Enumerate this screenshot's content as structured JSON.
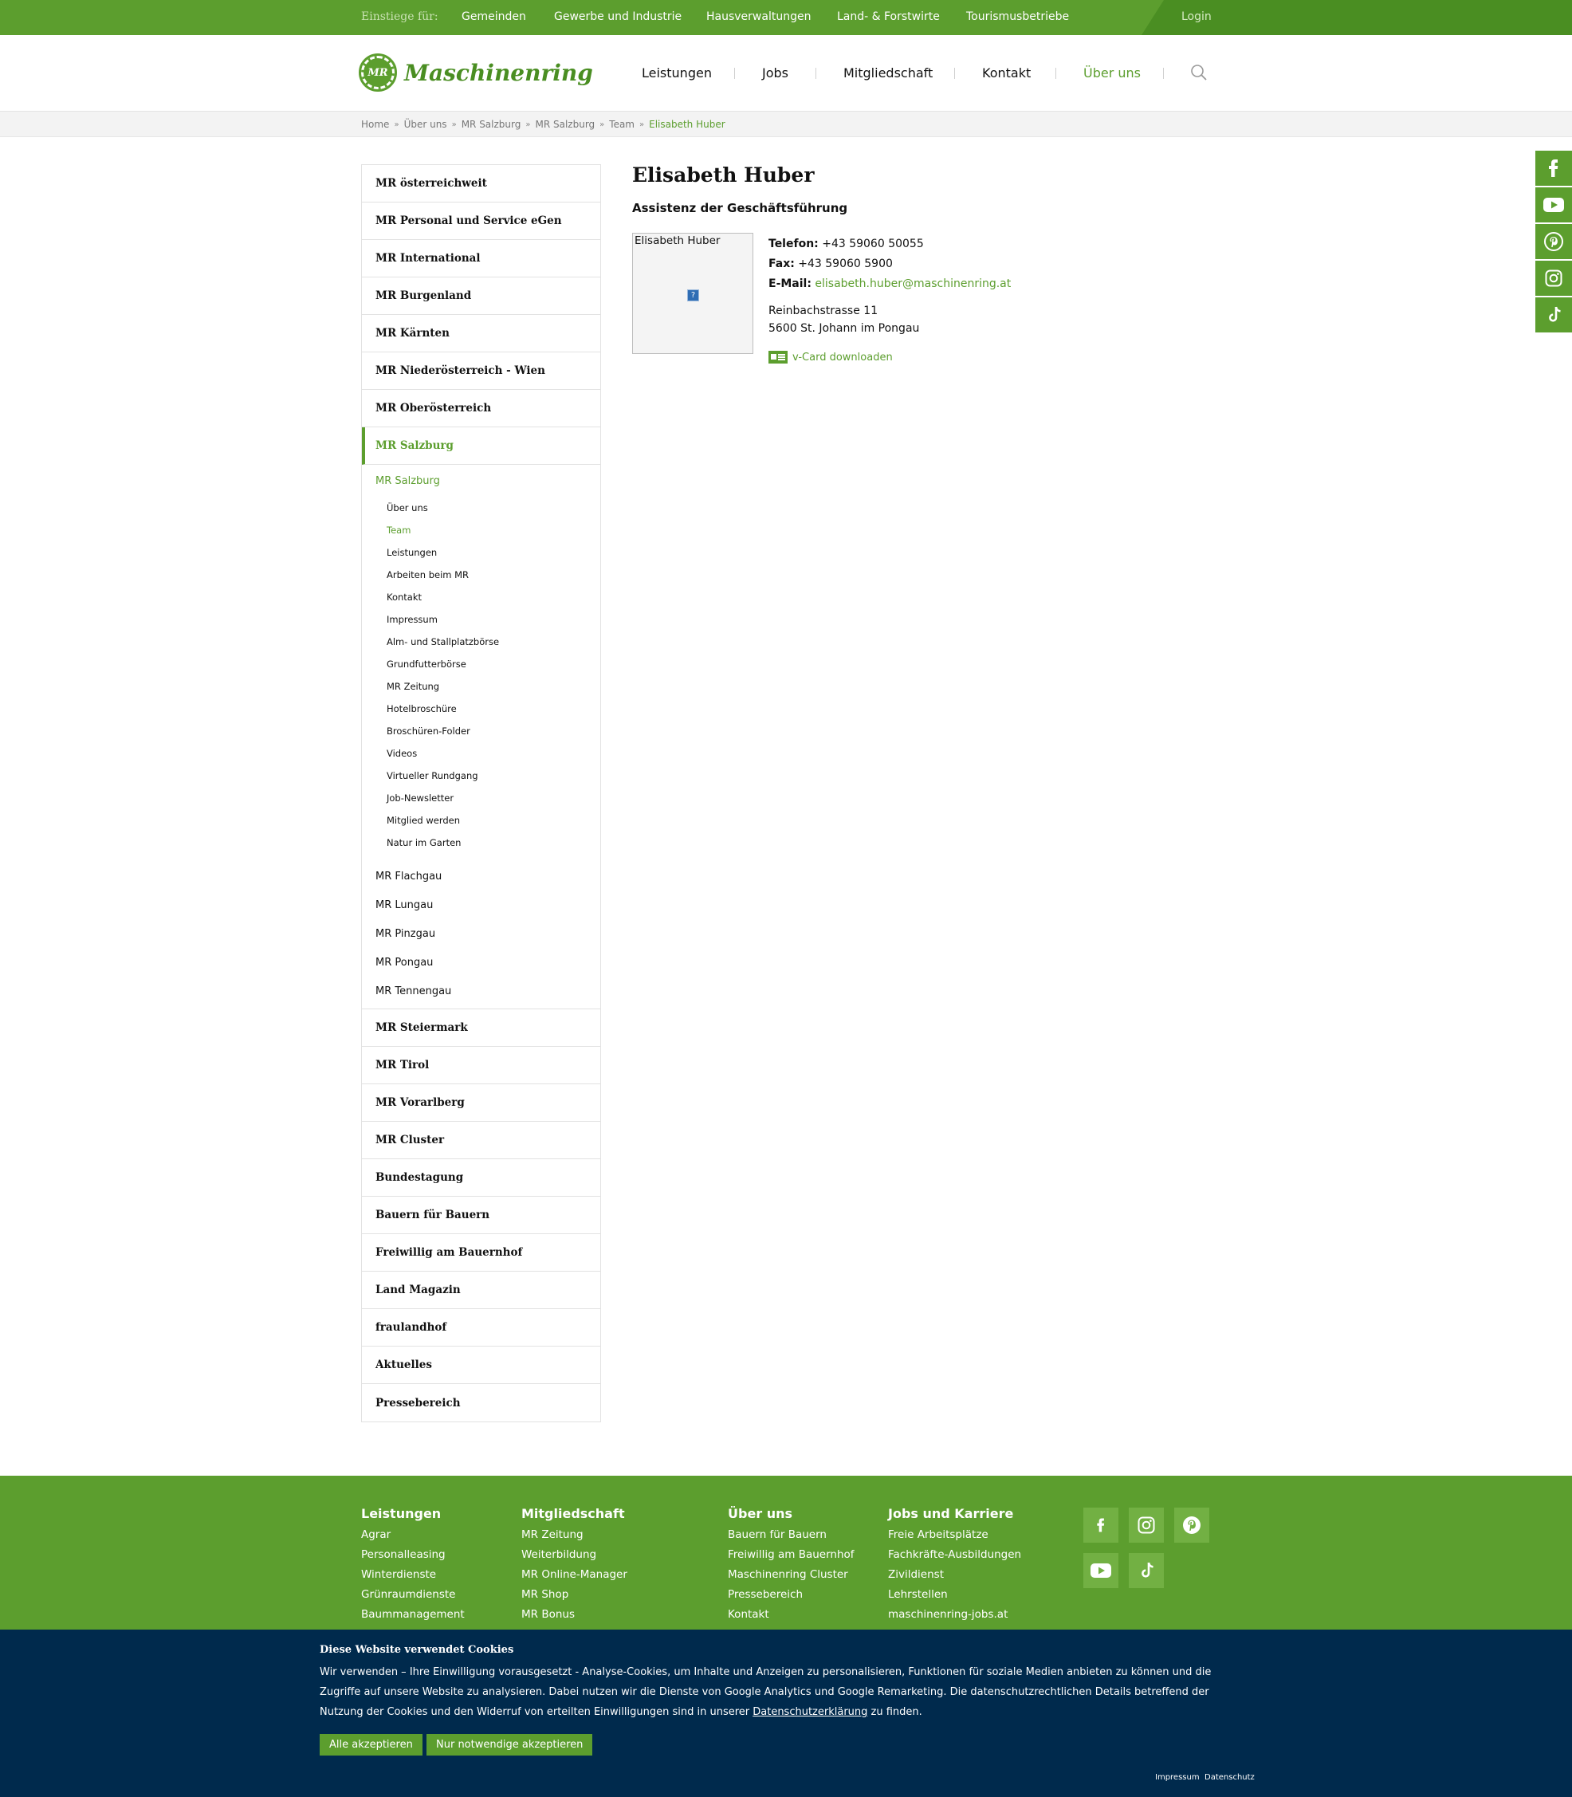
{
  "topbar": {
    "label": "Einstiege für:",
    "links": [
      "Gemeinden",
      "Gewerbe und Industrie",
      "Hausverwaltungen",
      "Land- & Forstwirte",
      "Tourismusbetriebe"
    ],
    "login": "Login"
  },
  "header": {
    "logo_mark": "MR",
    "logo_text": "Maschinenring",
    "nav": [
      "Leistungen",
      "Jobs",
      "Mitgliedschaft",
      "Kontakt",
      "Über uns"
    ],
    "active_nav": "Über uns"
  },
  "breadcrumb": [
    "Home",
    "Über uns",
    "MR Salzburg",
    "MR Salzburg",
    "Team",
    "Elisabeth Huber"
  ],
  "sidebar": {
    "top_before": [
      "MR österreichweit",
      "MR Personal und Service eGen",
      "MR International",
      "MR Burgenland",
      "MR Kärnten",
      "MR Niederösterreich - Wien",
      "MR Oberösterreich"
    ],
    "active": "MR Salzburg",
    "sub_active": "MR Salzburg",
    "third": [
      "Über uns",
      "Team",
      "Leistungen",
      "Arbeiten beim MR",
      "Kontakt",
      "Impressum",
      "Alm- und Stallplatzbörse",
      "Grundfutterbörse",
      "MR Zeitung",
      "Hotelbroschüre",
      "Broschüren-Folder",
      "Videos",
      "Virtueller Rundgang",
      "Job-Newsletter",
      "Mitglied werden",
      "Natur im Garten"
    ],
    "third_active": "Team",
    "sub_rest": [
      "MR Flachgau",
      "MR Lungau",
      "MR Pinzgau",
      "MR Pongau",
      "MR Tennengau"
    ],
    "top_after": [
      "MR Steiermark",
      "MR Tirol",
      "MR Vorarlberg",
      "MR Cluster",
      "Bundestagung",
      "Bauern für Bauern",
      "Freiwillig am Bauernhof",
      "Land Magazin",
      "fraulandhof",
      "Aktuelles",
      "Pressebereich"
    ]
  },
  "person": {
    "name": "Elisabeth Huber",
    "role": "Assistenz der Geschäftsführung",
    "photo_alt": "Elisabeth Huber",
    "phone_label": "Telefon:",
    "phone": "+43 59060 50055",
    "fax_label": "Fax:",
    "fax": "+43 59060 5900",
    "email_label": "E-Mail:",
    "email": "elisabeth.huber@maschinenring.at",
    "street": "Reinbachstrasse 11",
    "city": "5600 St. Johann im Pongau",
    "vcard": "v-Card downloaden"
  },
  "side_social": [
    "facebook-icon",
    "youtube-icon",
    "pinterest-icon",
    "instagram-icon",
    "tiktok-icon"
  ],
  "footer": {
    "columns": [
      {
        "title": "Leistungen",
        "items": [
          "Agrar",
          "Personalleasing",
          "Winterdienste",
          "Grünraumdienste",
          "Baummanagement"
        ]
      },
      {
        "title": "Mitgliedschaft",
        "items": [
          "MR Zeitung",
          "Weiterbildung",
          "MR Online-Manager",
          "MR Shop",
          "MR Bonus"
        ]
      },
      {
        "title": "Über uns",
        "items": [
          "Bauern für Bauern",
          "Freiwillig am Bauernhof",
          "Maschinenring Cluster",
          "Pressebereich",
          "Kontakt"
        ]
      },
      {
        "title": "Jobs und Karriere",
        "items": [
          "Freie Arbeitsplätze",
          "Fachkräfte-Ausbildungen",
          "Zivildienst",
          "Lehrstellen",
          "maschinenring-jobs.at"
        ]
      }
    ],
    "social": [
      "facebook-icon",
      "instagram-icon",
      "pinterest-icon",
      "youtube-icon",
      "tiktok-icon"
    ]
  },
  "cookie": {
    "title": "Diese Website verwendet Cookies",
    "text_before": "Wir verwenden – Ihre Einwilligung vorausgesetzt - Analyse-Cookies, um Inhalte und Anzeigen zu personalisieren, Funktionen für soziale Medien anbieten zu können und die Zugriffe auf unsere Website zu analysieren. Dabei nutzen wir die Dienste von Google Analytics und Google Remarketing. Die datenschutzrechtlichen Details betreffend der Nutzung der Cookies und den Widerruf von erteilten Einwilligungen sind in unserer ",
    "link": "Datenschutzerklärung",
    "text_after": " zu finden.",
    "accept_all": "Alle akzeptieren",
    "accept_needed": "Nur notwendige akzeptieren",
    "impressum": "Impressum",
    "datenschutz": "Datenschutz"
  },
  "colors": {
    "green": "#5c9e2e",
    "dark_green": "#4a8e22",
    "navy": "#002a4d"
  }
}
